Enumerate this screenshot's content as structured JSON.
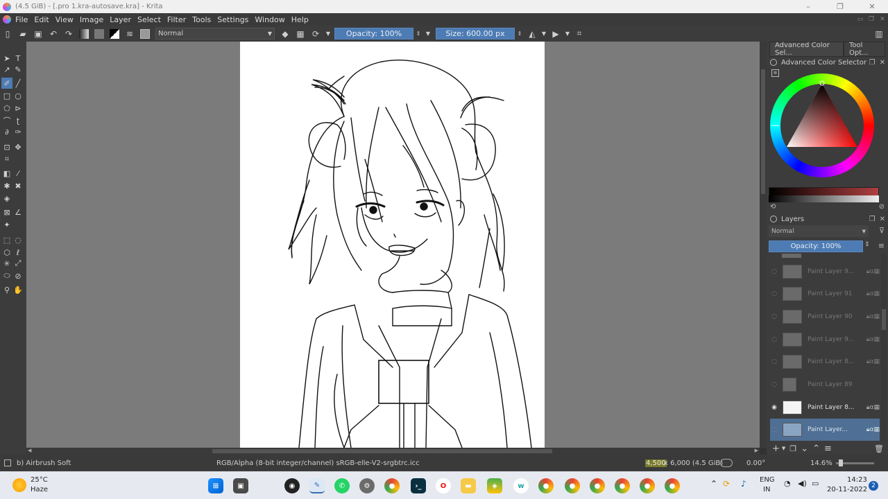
{
  "window": {
    "title": "(4.5 GiB) - [.pro 1.kra-autosave.kra] - Krita",
    "controls": [
      "–",
      "❐",
      "✕"
    ]
  },
  "menu": {
    "items": [
      "File",
      "Edit",
      "View",
      "Image",
      "Layer",
      "Select",
      "Filter",
      "Tools",
      "Settings",
      "Window",
      "Help"
    ]
  },
  "toolbar": {
    "blend_mode": "Normal",
    "opacity": "Opacity: 100%",
    "size": "Size: 600.00 px"
  },
  "dockers": {
    "tabs": [
      "Advanced Color Sel...",
      "Tool Opt..."
    ],
    "color_selector_title": "Advanced Color Selector",
    "layers_title": "Layers",
    "layers_blend": "Normal",
    "layers_opacity": "Opacity:  100%",
    "layers": [
      {
        "name": "Paint Layer 9...",
        "visible": false,
        "selected": false
      },
      {
        "name": "Paint Layer 91",
        "visible": false,
        "selected": false
      },
      {
        "name": "Paint Layer 90",
        "visible": false,
        "selected": false
      },
      {
        "name": "Paint Layer 9...",
        "visible": false,
        "selected": false
      },
      {
        "name": "Paint Layer 8...",
        "visible": false,
        "selected": false
      },
      {
        "name": "Paint Layer 89",
        "visible": false,
        "selected": false
      },
      {
        "name": "Paint Layer 8...",
        "visible": true,
        "selected": false
      },
      {
        "name": "Paint Layer...",
        "visible": false,
        "selected": true
      }
    ]
  },
  "status": {
    "brush": "b) Airbrush Soft",
    "colorspace": "RGB/Alpha (8-bit integer/channel)  sRGB-elle-V2-srgbtrc.icc",
    "dimensions_w": "4,500",
    "dimensions_rest": "x 6,000 (4.5 GiB)",
    "rotation": "0.00°",
    "zoom": "14.6%"
  },
  "taskbar": {
    "weather_temp": "25°C",
    "weather_desc": "Haze",
    "lang1": "ENG",
    "lang2": "IN",
    "time": "14:23",
    "date": "20-11-2022",
    "notif": "2"
  },
  "colors": {
    "accent": "#4d7bb3",
    "panel": "#3c3c3c",
    "canvas_bg": "#7b7b7b"
  }
}
